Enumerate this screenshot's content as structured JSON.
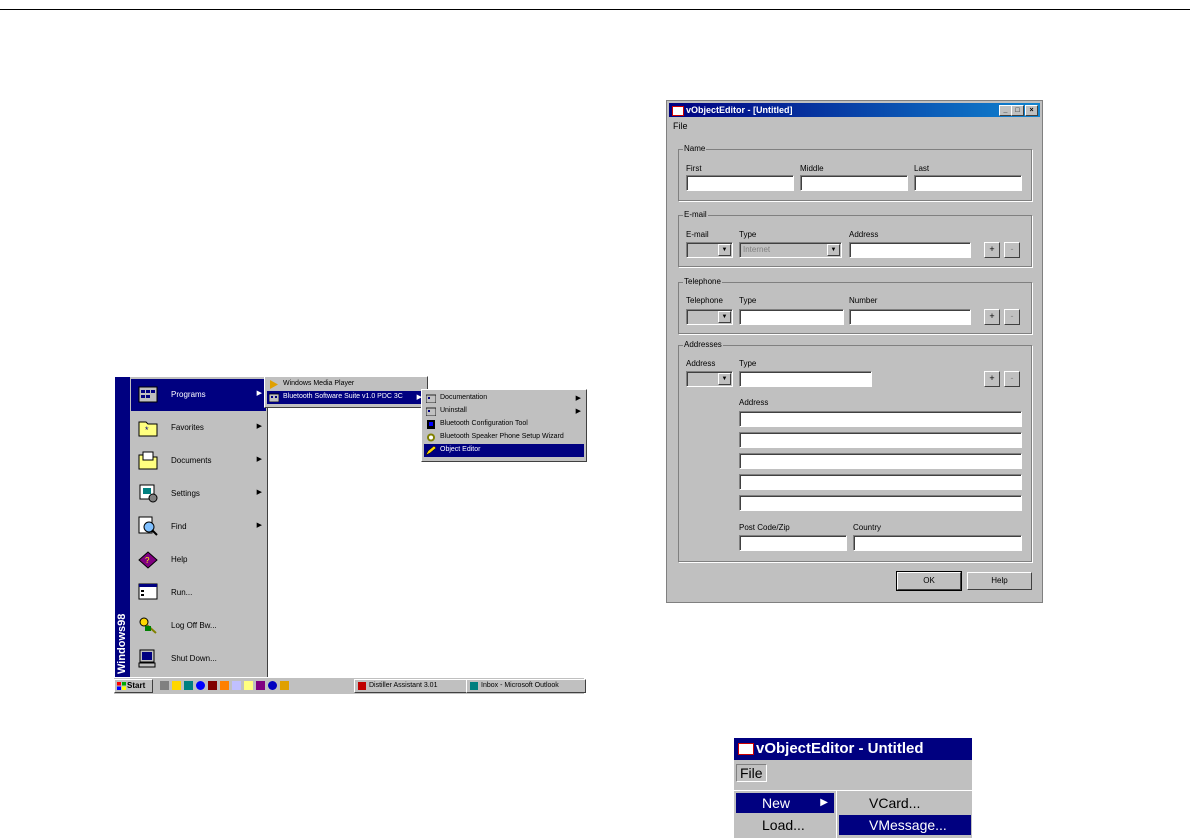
{
  "start_menu": {
    "sidebar_text": "Windows98",
    "items": [
      {
        "label": "Programs",
        "icon": "programs-folder-icon"
      },
      {
        "label": "Favorites",
        "icon": "favorites-folder-icon"
      },
      {
        "label": "Documents",
        "icon": "documents-folder-icon"
      },
      {
        "label": "Settings",
        "icon": "settings-icon"
      },
      {
        "label": "Find",
        "icon": "find-icon"
      },
      {
        "label": "Help",
        "icon": "help-book-icon"
      },
      {
        "label": "Run...",
        "icon": "run-icon"
      },
      {
        "label": "Log Off Bw...",
        "icon": "log-off-key-icon"
      },
      {
        "label": "Shut Down...",
        "icon": "shut-down-computer-icon"
      }
    ]
  },
  "programs_submenu": {
    "items": [
      {
        "label": "Windows Media Player"
      },
      {
        "label": "Bluetooth Software Suite v1.0 PDC 3C"
      }
    ]
  },
  "bluetooth_submenu": {
    "items": [
      {
        "label": "Documentation"
      },
      {
        "label": "Uninstall"
      },
      {
        "label": "Bluetooth Configuration Tool"
      },
      {
        "label": "Bluetooth Speaker Phone Setup Wizard"
      },
      {
        "label": "Object Editor"
      }
    ]
  },
  "taskbar": {
    "start_label": "Start",
    "tasks": [
      {
        "label": "Distiller Assistant 3.01"
      },
      {
        "label": "Inbox - Microsoft Outlook"
      }
    ]
  },
  "dialog": {
    "title": "vObjectEditor - [Untitled]",
    "menu_file": "File",
    "name_group": {
      "legend": "Name",
      "first": "First",
      "middle": "Middle",
      "last": "Last"
    },
    "email_group": {
      "legend": "E-mail",
      "email": "E-mail",
      "type": "Type",
      "type_value": "Internet",
      "address": "Address"
    },
    "telephone_group": {
      "legend": "Telephone",
      "telephone": "Telephone",
      "type": "Type",
      "number": "Number"
    },
    "addresses_group": {
      "legend": "Addresses",
      "address": "Address",
      "type": "Type",
      "address_lines": "Address",
      "postcode": "Post Code/Zip",
      "country": "Country"
    },
    "plus": "+",
    "minus": "-",
    "ok": "OK",
    "help": "Help"
  },
  "crop": {
    "title": "vObjectEditor - Untitled",
    "menu_file": "File",
    "file_menu": [
      {
        "label": "New"
      },
      {
        "label": "Load..."
      }
    ],
    "new_submenu": [
      {
        "label": "VCard..."
      },
      {
        "label": "VMessage..."
      }
    ]
  }
}
